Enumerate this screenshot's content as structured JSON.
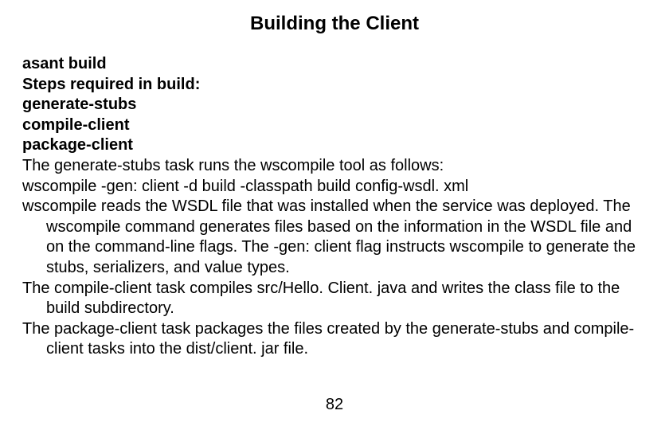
{
  "title": "Building the Client",
  "lines": {
    "l1": "asant build",
    "l2": "Steps required in build:",
    "l3": "generate-stubs",
    "l4": "compile-client",
    "l5": "package-client",
    "l6": "The generate-stubs task runs the wscompile tool as follows:",
    "l7": "wscompile -gen: client -d build -classpath build config-wsdl. xml",
    "l8": "wscompile reads the WSDL file that was installed when the service was deployed. The wscompile command generates files based on the information in the WSDL file and on the command-line flags. The -gen: client flag instructs wscompile to generate the stubs, serializers, and value types.",
    "l9": "The compile-client task compiles src/Hello. Client. java and writes the class file to the build subdirectory.",
    "l10": "The package-client task packages the files created by the generate-stubs and compile-client tasks into the dist/client. jar file."
  },
  "page_number": "82"
}
